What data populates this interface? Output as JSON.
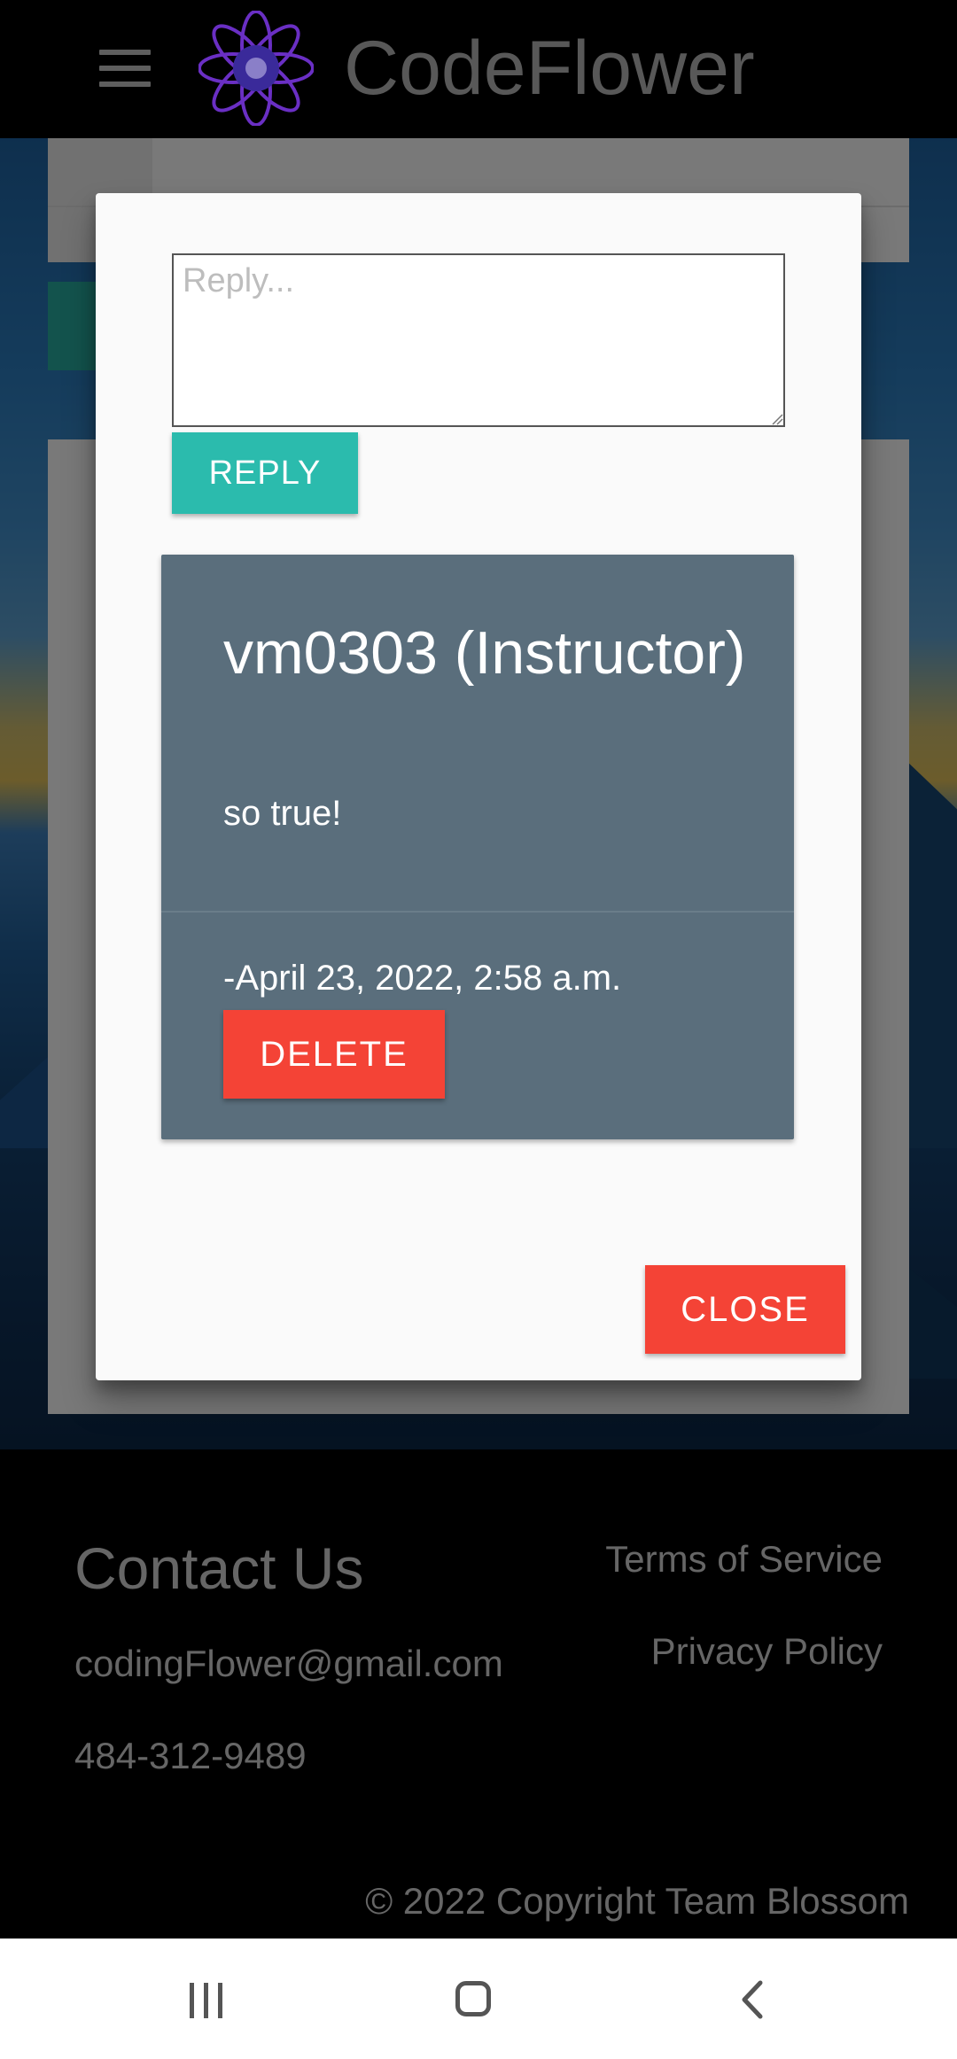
{
  "header": {
    "brand": "CodeFlower",
    "menu_icon": "hamburger-menu-icon",
    "logo_icon": "flower-logo-icon"
  },
  "modal": {
    "reply_placeholder": "Reply...",
    "reply_value": "",
    "reply_button": "REPLY",
    "comment": {
      "author": "vm0303 (Instructor)",
      "text": "so true!",
      "timestamp": "-April 23, 2022, 2:58 a.m.",
      "delete_button": "DELETE"
    },
    "close_button": "CLOSE"
  },
  "footer": {
    "contact_title": "Contact Us",
    "email": "codingFlower@gmail.com",
    "phone": "484-312-9489",
    "terms": "Terms of Service",
    "privacy": "Privacy Policy",
    "copyright": "© 2022 Copyright Team Blossom"
  },
  "navbar": {
    "recent_icon": "recent-apps-icon",
    "home_icon": "home-icon",
    "back_icon": "back-icon"
  },
  "colors": {
    "reply_button": "#2bbbad",
    "danger_button": "#f44336",
    "comment_card": "#5a6e7c",
    "logo": "#7b3fd6"
  }
}
